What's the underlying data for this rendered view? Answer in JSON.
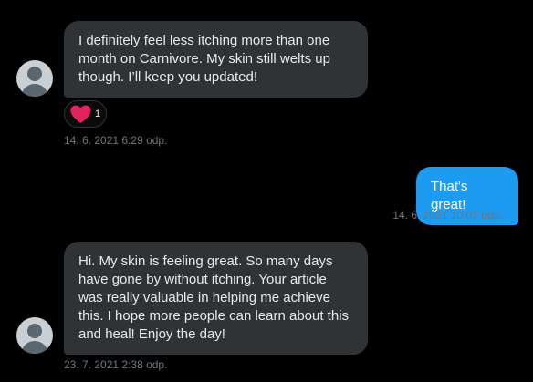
{
  "messages": [
    {
      "direction": "incoming",
      "text": "I definitely feel less itching more than one month on Carnivore. My skin still welts up though. I’ll keep you updated!",
      "reaction": {
        "icon": "heart-icon",
        "count": "1"
      },
      "timestamp": "14. 6. 2021 6:29 odp."
    },
    {
      "direction": "outgoing",
      "text": "That's great!",
      "timestamp": "14. 6. 2021 10:07 odp.",
      "status_icon": "checkmark-icon"
    },
    {
      "direction": "incoming",
      "text": "Hi. My skin is feeling great. So many days have gone by without itching. Your article was really valuable in helping me achieve this. I hope more people can learn about this and heal! Enjoy the day!",
      "timestamp": "23. 7. 2021 2:38 odp."
    }
  ],
  "colors": {
    "background": "#000000",
    "incoming_bubble": "#2f3336",
    "outgoing_bubble": "#1d9bf0",
    "timestamp": "#71767b",
    "heart": "#f91880"
  }
}
